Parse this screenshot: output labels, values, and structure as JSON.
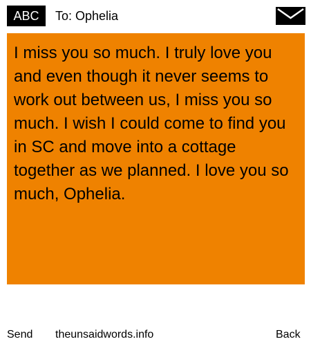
{
  "header": {
    "badge_label": "ABC",
    "to_text": "To: Ophelia",
    "icon": "envelope-icon"
  },
  "message": {
    "body": "I miss you so much. I truly love you and even though it never seems to work out between us, I miss you so much. I wish I could come to find you in SC and move into a cottage together as we planned. I love you so much, Ophelia."
  },
  "footer": {
    "send_label": "Send",
    "site_label": "theunsaidwords.info",
    "back_label": "Back"
  },
  "colors": {
    "message_background": "#ef8200",
    "badge_background": "#000000",
    "page_background": "#ffffff"
  }
}
